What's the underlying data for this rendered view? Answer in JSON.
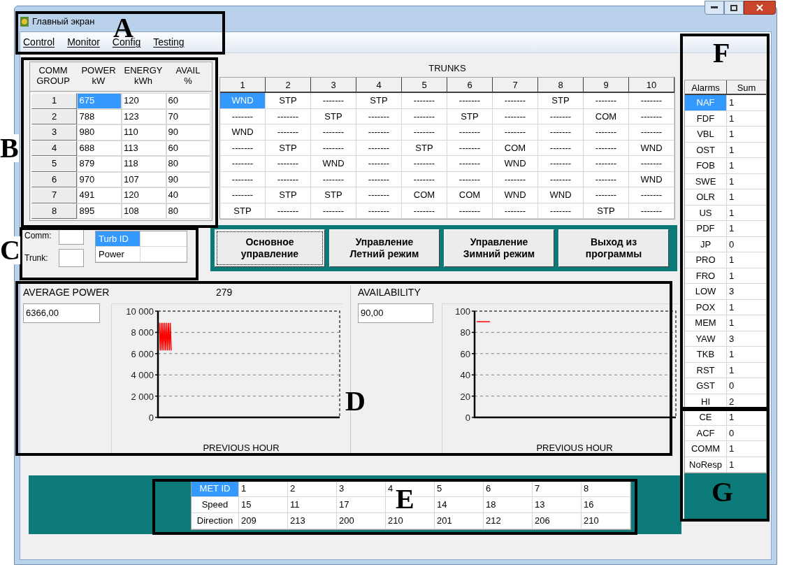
{
  "window": {
    "title": "Главный экран"
  },
  "menu": [
    "Control",
    "Monitor",
    "Config",
    "Testing"
  ],
  "comm_groups": {
    "columns": [
      "COMM\nGROUP",
      "POWER\nkW",
      "ENERGY\nkWh",
      "AVAIL\n%"
    ],
    "rows": [
      {
        "group": "1",
        "power": "675",
        "energy": "120",
        "avail": "60",
        "selected": true
      },
      {
        "group": "2",
        "power": "788",
        "energy": "123",
        "avail": "70",
        "selected": false
      },
      {
        "group": "3",
        "power": "980",
        "energy": "110",
        "avail": "90",
        "selected": false
      },
      {
        "group": "4",
        "power": "688",
        "energy": "113",
        "avail": "60",
        "selected": false
      },
      {
        "group": "5",
        "power": "879",
        "energy": "118",
        "avail": "80",
        "selected": false
      },
      {
        "group": "6",
        "power": "970",
        "energy": "107",
        "avail": "90",
        "selected": false
      },
      {
        "group": "7",
        "power": "491",
        "energy": "120",
        "avail": "40",
        "selected": false
      },
      {
        "group": "8",
        "power": "895",
        "energy": "108",
        "avail": "80",
        "selected": false
      }
    ]
  },
  "trunks": {
    "title": "TRUNKS",
    "columns": [
      "1",
      "2",
      "3",
      "4",
      "5",
      "6",
      "7",
      "8",
      "9",
      "10"
    ],
    "rows": [
      {
        "selected": true,
        "cells": [
          "WND",
          "STP",
          "-------",
          "STP",
          "-------",
          "-------",
          "-------",
          "STP",
          "-------",
          "-------"
        ]
      },
      {
        "selected": false,
        "cells": [
          "-------",
          "-------",
          "STP",
          "-------",
          "-------",
          "STP",
          "-------",
          "-------",
          "COM",
          "-------"
        ]
      },
      {
        "selected": false,
        "cells": [
          "WND",
          "-------",
          "-------",
          "-------",
          "-------",
          "-------",
          "-------",
          "-------",
          "-------",
          "-------"
        ]
      },
      {
        "selected": false,
        "cells": [
          "-------",
          "STP",
          "-------",
          "-------",
          "STP",
          "-------",
          "COM",
          "-------",
          "-------",
          "WND"
        ]
      },
      {
        "selected": false,
        "cells": [
          "-------",
          "-------",
          "WND",
          "-------",
          "-------",
          "-------",
          "WND",
          "-------",
          "-------",
          "-------"
        ]
      },
      {
        "selected": false,
        "cells": [
          "-------",
          "-------",
          "-------",
          "-------",
          "-------",
          "-------",
          "-------",
          "-------",
          "-------",
          "WND"
        ]
      },
      {
        "selected": false,
        "cells": [
          "-------",
          "STP",
          "STP",
          "-------",
          "COM",
          "COM",
          "WND",
          "WND",
          "-------",
          "-------"
        ]
      },
      {
        "selected": false,
        "cells": [
          "STP",
          "-------",
          "-------",
          "-------",
          "-------",
          "-------",
          "-------",
          "-------",
          "STP",
          "-------"
        ]
      }
    ]
  },
  "lookup": {
    "fields": [
      "Comm:",
      "Trunk:"
    ],
    "grid": [
      {
        "label": "Turb ID",
        "selected": true
      },
      {
        "label": "Power",
        "selected": false
      }
    ]
  },
  "buttons": [
    {
      "label": "Основное\nуправление",
      "focused": true
    },
    {
      "label": "Управление\nЛетний режим",
      "focused": false
    },
    {
      "label": "Управление\nЗимний режим",
      "focused": false
    },
    {
      "label": "Выход из\nпрограммы",
      "focused": false
    }
  ],
  "average_power": {
    "label": "AVERAGE POWER",
    "value": "6366,00",
    "counter": "279",
    "plot": {
      "kind": "spikes",
      "xlabel": "PREVIOUS HOUR",
      "y_labels": [
        "10 000",
        "8 000",
        "6 000",
        "4 000",
        "2 000",
        "0"
      ]
    }
  },
  "availability": {
    "label": "AVAILABILITY",
    "value": "90,00",
    "plot": {
      "kind": "flat",
      "xlabel": "PREVIOUS HOUR",
      "y_labels": [
        "100",
        "80",
        "60",
        "40",
        "20",
        "0"
      ]
    }
  },
  "met": {
    "rows": [
      {
        "label": "MET ID",
        "selected": true,
        "values": [
          "1",
          "2",
          "3",
          "4",
          "5",
          "6",
          "7",
          "8"
        ]
      },
      {
        "label": "Speed",
        "selected": false,
        "values": [
          "15",
          "11",
          "17",
          {
            "covered": true
          },
          "14",
          "18",
          "13",
          "16"
        ]
      },
      {
        "label": "Direction",
        "selected": false,
        "values": [
          "209",
          "213",
          "200",
          "210",
          "201",
          "212",
          "206",
          "210"
        ]
      }
    ]
  },
  "alarms": {
    "columns": [
      "Alarms",
      "Sum"
    ],
    "rows": [
      {
        "code": "NAF",
        "sum": "1",
        "selected": true
      },
      {
        "code": "FDF",
        "sum": "1",
        "selected": false
      },
      {
        "code": "VBL",
        "sum": "1",
        "selected": false
      },
      {
        "code": "OST",
        "sum": "1",
        "selected": false
      },
      {
        "code": "FOB",
        "sum": "1",
        "selected": false
      },
      {
        "code": "SWE",
        "sum": "1",
        "selected": false
      },
      {
        "code": "OLR",
        "sum": "1",
        "selected": false
      },
      {
        "code": "US",
        "sum": "1",
        "selected": false
      },
      {
        "code": "PDF",
        "sum": "1",
        "selected": false
      },
      {
        "code": "JP",
        "sum": "0",
        "selected": false
      },
      {
        "code": "PRO",
        "sum": "1",
        "selected": false
      },
      {
        "code": "FRO",
        "sum": "1",
        "selected": false
      },
      {
        "code": "LOW",
        "sum": "3",
        "selected": false
      },
      {
        "code": "POX",
        "sum": "1",
        "selected": false
      },
      {
        "code": "MEM",
        "sum": "1",
        "selected": false
      },
      {
        "code": "YAW",
        "sum": "3",
        "selected": false
      },
      {
        "code": "TKB",
        "sum": "1",
        "selected": false
      },
      {
        "code": "RST",
        "sum": "1",
        "selected": false
      },
      {
        "code": "GST",
        "sum": "0",
        "selected": false
      },
      {
        "code": "HI",
        "sum": "2",
        "selected": false
      },
      {
        "code": "CE",
        "sum": "1",
        "selected": false
      },
      {
        "code": "ACF",
        "sum": "0",
        "selected": false
      },
      {
        "code": "COMM",
        "sum": "1",
        "selected": false
      },
      {
        "code": "NoResp",
        "sum": "1",
        "selected": false
      }
    ]
  },
  "annotations": [
    {
      "label": "A"
    },
    {
      "label": "B"
    },
    {
      "label": "C"
    },
    {
      "label": "D"
    },
    {
      "label": "E"
    },
    {
      "label": "F"
    },
    {
      "label": "G"
    }
  ]
}
